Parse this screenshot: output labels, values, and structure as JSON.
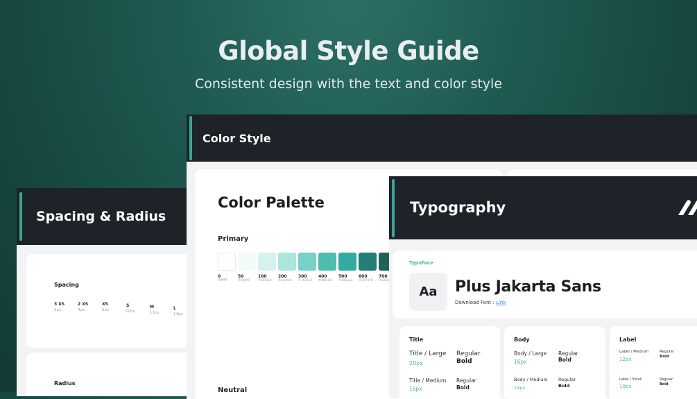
{
  "hero": {
    "title": "Global Style Guide",
    "subtitle": "Consistent design with the text and color  style"
  },
  "spacing_card": {
    "title": "Spacing & Radius",
    "spacing_label": "Spacing",
    "radius_label": "Radius",
    "items": [
      {
        "name": "3 XS",
        "value": "2px"
      },
      {
        "name": "2 XS",
        "value": "4px"
      },
      {
        "name": "XS",
        "value": "6px"
      },
      {
        "name": "S",
        "value": "10px"
      },
      {
        "name": "M",
        "value": "12px"
      },
      {
        "name": "L",
        "value": "14px"
      }
    ]
  },
  "color_card": {
    "title": "Color Style",
    "palette_title": "Color Palette",
    "primary_label": "Primary",
    "neutral_label": "Neutral",
    "swatches": [
      {
        "step": "0",
        "hex": "#ffffff"
      },
      {
        "step": "50",
        "hex": "#f2fbf9"
      },
      {
        "step": "100",
        "hex": "#d4f3ed"
      },
      {
        "step": "200",
        "hex": "#a9e6dc"
      },
      {
        "step": "300",
        "hex": "#76d1c7"
      },
      {
        "step": "400",
        "hex": "#4fbcb0"
      },
      {
        "step": "500",
        "hex": "#34aaa1"
      },
      {
        "step": "600",
        "hex": "#247d78"
      },
      {
        "step": "700",
        "hex": "#22605b"
      }
    ]
  },
  "type_card": {
    "title": "Typography",
    "typeface_label": "Typeface",
    "sample_glyph": "Aa",
    "font_name": "Plus Jakarta Sans",
    "download_prefix": "Download Font : ",
    "download_link": "Link",
    "sections": {
      "title": {
        "heading": "Title",
        "rows": [
          {
            "name": "Title / Large",
            "size": "20px",
            "w1": "Regular",
            "w2": "Bold"
          },
          {
            "name": "Title / Medium",
            "size": "16px",
            "w1": "Regular",
            "w2": "Bold"
          }
        ]
      },
      "body": {
        "heading": "Body",
        "rows": [
          {
            "name": "Body / Large",
            "size": "16px",
            "w1": "Regular",
            "w2": "Bold"
          },
          {
            "name": "Body / Medium",
            "size": "14px",
            "w1": "Regular",
            "w2": "Bold"
          }
        ]
      },
      "label": {
        "heading": "Label",
        "rows": [
          {
            "name": "Label / Medium",
            "size": "12px",
            "w1": "Regular",
            "w2": "Bold"
          },
          {
            "name": "Label / Small",
            "size": "10px",
            "w1": "Regular",
            "w2": "Bold"
          }
        ]
      }
    }
  },
  "colors": {
    "accent": "#3aa595",
    "header_bg": "#1e2329",
    "link": "#3b82f6"
  }
}
